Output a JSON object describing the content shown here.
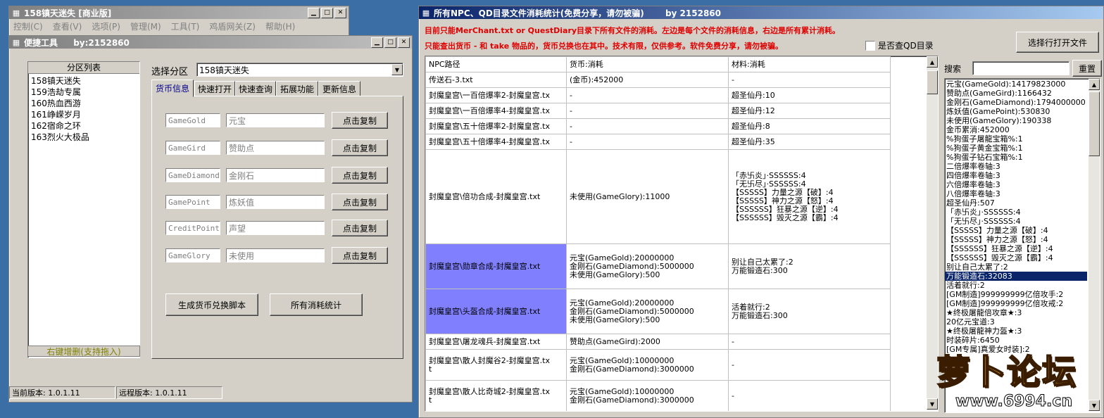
{
  "main_window": {
    "title": "158镇天迷失 [商业版]",
    "menu": [
      "控制(C)",
      "查看(V)",
      "选项(P)",
      "管理(M)",
      "工具(T)",
      "鸡盾网关(Z)",
      "帮助(H)"
    ]
  },
  "tool_window": {
    "title": "便捷工具",
    "author": "by:2152860",
    "region_list_header": "分区列表",
    "regions": [
      "158镇天迷失",
      "159浩劫专属",
      "160热血西游",
      "161峥嵘岁月",
      "162宿命之环",
      "163烈火大极品"
    ],
    "region_list_footer": "右键增删(支持拖入)",
    "select_label": "选择分区",
    "select_value": "158镇天迷失",
    "tabs": [
      "货币信息",
      "快速打开",
      "快速查询",
      "拓展功能",
      "更新信息"
    ],
    "currency_rows": [
      {
        "code": "GameGold",
        "name": "元宝",
        "button": "点击复制"
      },
      {
        "code": "GameGird",
        "name": "赞助点",
        "button": "点击复制"
      },
      {
        "code": "GameDiamond",
        "name": "金刚石",
        "button": "点击复制"
      },
      {
        "code": "GamePoint",
        "name": "炼妖值",
        "button": "点击复制"
      },
      {
        "code": "CreditPoint",
        "name": "声望",
        "button": "点击复制"
      },
      {
        "code": "GameGlory",
        "name": "未使用",
        "button": "点击复制"
      }
    ],
    "generate_button": "生成货币兑换脚本",
    "stats_button": "所有消耗统计",
    "status_current": "当前版本: 1.0.1.11",
    "status_remote": "远程版本: 1.0.1.11"
  },
  "stats_window": {
    "title": "所有NPC、QD目录文件消耗统计(免费分享，请勿被骗)",
    "author": "by 2152860",
    "notice_line1": "目前只能MerChant.txt or QuestDiary目录下所有文件的消耗。左边是每个文件的消耗信息，右边是所有累计消耗。",
    "notice_line2": "只能查出货币 - 和 take 物品的，货币兑换也在其中。技术有限，仅供参考。软件免费分享，请勿被骗。",
    "checkbox_label": "是否查QD目录",
    "open_file_button": "选择行打开文件",
    "search_label": "搜索",
    "search_value": "",
    "reset_button": "重置",
    "table_headers": [
      "NPC路径",
      "货币:消耗",
      "材料:消耗"
    ],
    "table_rows": [
      {
        "path": "传送石-3.txt",
        "currency": "(金币):452000",
        "material": "-",
        "hl": false
      },
      {
        "path": "封魔皇宫\\一百倍爆率2-封魔皇宫.tx",
        "currency": "-",
        "material": "超圣仙丹:10",
        "hl": false
      },
      {
        "path": "封魔皇宫\\一百倍爆率4-封魔皇宫.tx",
        "currency": "-",
        "material": "超圣仙丹:12",
        "hl": false
      },
      {
        "path": "封魔皇宫\\五十倍爆率2-封魔皇宫.tx",
        "currency": "-",
        "material": "超圣仙丹:8",
        "hl": false
      },
      {
        "path": "封魔皇宫\\五十倍爆率4-封魔皇宫.tx",
        "currency": "-",
        "material": "超圣仙丹:35",
        "hl": false
      },
      {
        "path": "封魔皇宫\\倍功合成-封魔皇宫.txt",
        "currency": "未使用(GameGlory):11000",
        "material": "「赤卐炎」·SSSSSS:4\n「无卐尽」·SSSSSS:4\n【SSSSS】力量之源【破】:4\n【SSSSS】神力之源【怒】:4\n【SSSSSS】狂暴之源【逆】:4\n【SSSSSS】毁灭之源【霸】:4",
        "hl": false
      },
      {
        "path": "封魔皇宫\\勋章合成-封魔皇宫.txt",
        "currency": "元宝(GameGold):20000000\n金刚石(GameDiamond):5000000\n未使用(GameGlory):500",
        "material": "别让自己太累了:2\n万能锻造石:300",
        "hl": true
      },
      {
        "path": "封魔皇宫\\头盔合成-封魔皇宫.txt",
        "currency": "元宝(GameGold):20000000\n金刚石(GameDiamond):5000000\n未使用(GameGlory):500",
        "material": "活着就行:2\n万能锻造石:300",
        "hl": true
      },
      {
        "path": "封魔皇宫\\屠龙魂兵-封魔皇宫.txt",
        "currency": "赞助点(GameGird):2000",
        "material": "-",
        "hl": false
      },
      {
        "path": "封魔皇宫\\散人封魔谷2-封魔皇宫.tx\nt",
        "currency": "元宝(GameGold):10000000\n金刚石(GameDiamond):3000000",
        "material": "-",
        "hl": false
      },
      {
        "path": "封魔皇宫\\散人比奇城2-封魔皇宫.tx\nt",
        "currency": "元宝(GameGold):10000000\n金刚石(GameDiamond):3000000",
        "material": "-",
        "hl": false
      }
    ],
    "totals": [
      "元宝(GameGold):14179823000",
      "赞助点(GameGird):1166432",
      "金刚石(GameDiamond):1794000000",
      "炼妖值(GamePoint):530830",
      "未使用(GameGlory):190338",
      "金币累消:452000",
      "%狗蛋子屠龍宝箱%:1",
      "%狗蛋子黄金宝箱%:1",
      "%狗蛋子钻石宝箱%:1",
      "二倍爆率卷轴:3",
      "四倍爆率卷轴:3",
      "六倍爆率卷轴:3",
      "八倍爆率卷轴:3",
      "超圣仙丹:507",
      "「赤卐炎」·SSSSSS:4",
      "「无卐尽」·SSSSSS:4",
      "【SSSSS】力量之源【破】:4",
      "【SSSSS】神力之源【怒】:4",
      "【SSSSSS】狂暴之源【逆】:4",
      "【SSSSSS】毁灭之源【霸】:4",
      "别让自己太累了:2",
      "万能锻造石:32083",
      "活着就行:2",
      "[GM制造]999999999亿倍攻手:2",
      "[GM制造]999999999亿倍攻戒:2",
      "★终极屠龍倍攻章★:3",
      "20亿元宝道:3",
      "★终极屠龍神力盔★:3",
      "时装碎片:6450",
      "[GM专属]真爱女时装]:2"
    ],
    "selected_total_index": 21
  },
  "watermark": {
    "text": "萝卜论坛",
    "url": "www.6994.cn"
  }
}
